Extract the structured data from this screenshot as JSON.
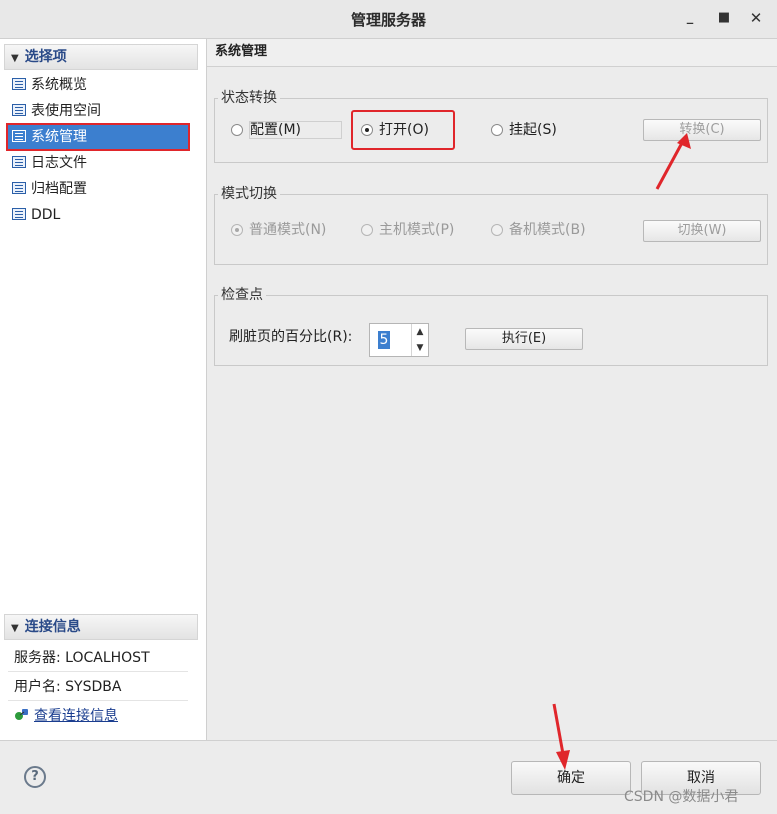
{
  "window": {
    "title": "管理服务器",
    "minimize_icon": "minimize-icon",
    "maximize_icon": "maximize-icon",
    "close_icon": "close-icon"
  },
  "sidebar": {
    "options_header": "选择项",
    "items": [
      {
        "label": "系统概览",
        "icon": "list-icon",
        "selected": false
      },
      {
        "label": "表使用空间",
        "icon": "list-icon",
        "selected": false
      },
      {
        "label": "系统管理",
        "icon": "list-icon",
        "selected": true
      },
      {
        "label": "日志文件",
        "icon": "list-icon",
        "selected": false
      },
      {
        "label": "归档配置",
        "icon": "list-icon",
        "selected": false
      },
      {
        "label": "DDL",
        "icon": "list-icon",
        "selected": false
      }
    ],
    "connection_header": "连接信息",
    "server_line": "服务器: LOCALHOST",
    "user_line": "用户名: SYSDBA",
    "view_connection_link": "查看连接信息"
  },
  "main": {
    "title": "系统管理",
    "state_group": {
      "label": "状态转换",
      "options": [
        "配置(M)",
        "打开(O)",
        "挂起(S)"
      ],
      "selected": "打开(O)",
      "button": "转换(C)"
    },
    "mode_group": {
      "label": "模式切换",
      "options": [
        "普通模式(N)",
        "主机模式(P)",
        "备机模式(B)"
      ],
      "selected": "普通模式(N)",
      "button": "切换(W)"
    },
    "checkpoint_group": {
      "label": "检查点",
      "field_label": "刷脏页的百分比(R):",
      "field_value": "5",
      "button": "执行(E)"
    }
  },
  "footer": {
    "ok_label": "确定",
    "cancel_label": "取消",
    "watermark": "CSDN @数据小君"
  },
  "colors": {
    "accent": "#3c7fcf",
    "highlight_red": "#e0262b"
  }
}
